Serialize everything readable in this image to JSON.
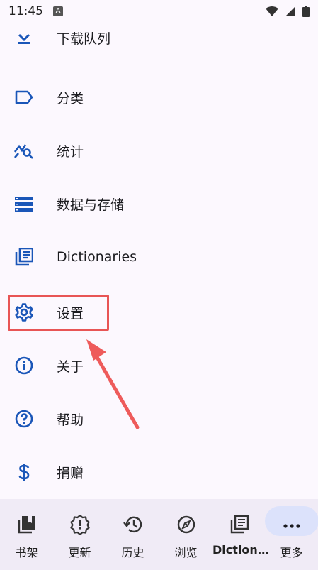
{
  "status_bar": {
    "time": "11:45",
    "notification_icon": "A"
  },
  "menu": {
    "items": [
      {
        "label": "下载队列",
        "icon": "download-icon"
      },
      {
        "label": "分类",
        "icon": "label-icon"
      },
      {
        "label": "统计",
        "icon": "stats-icon"
      },
      {
        "label": "数据与存储",
        "icon": "storage-icon"
      },
      {
        "label": "Dictionaries",
        "icon": "dictionary-icon"
      },
      {
        "label": "设置",
        "icon": "gear-icon"
      },
      {
        "label": "关于",
        "icon": "info-icon"
      },
      {
        "label": "帮助",
        "icon": "help-icon"
      },
      {
        "label": "捐赠",
        "icon": "dollar-icon"
      }
    ]
  },
  "bottom_nav": {
    "tabs": [
      {
        "label": "书架",
        "icon": "library-icon"
      },
      {
        "label": "更新",
        "icon": "updates-icon"
      },
      {
        "label": "历史",
        "icon": "history-icon"
      },
      {
        "label": "浏览",
        "icon": "compass-icon"
      },
      {
        "label": "Diction…",
        "icon": "dictionary-icon"
      },
      {
        "label": "更多",
        "icon": "more-icon"
      }
    ],
    "active_tab": "更多"
  },
  "colors": {
    "icon_blue": "#1a56b8",
    "highlight_red": "#e85555",
    "active_pill": "#dce2fb"
  }
}
